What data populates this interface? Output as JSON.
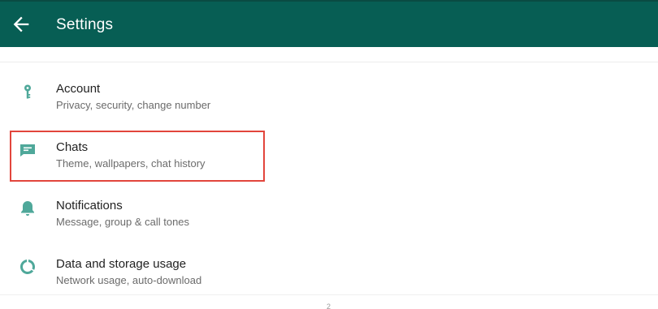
{
  "header": {
    "title": "Settings",
    "back_icon": "arrow-left-icon"
  },
  "colors": {
    "header_bg": "#075e54",
    "accent_icon": "#4fa89a",
    "highlight_border": "#e2453c"
  },
  "settings": {
    "items": [
      {
        "label": "Account",
        "subtitle": "Privacy, security, change number",
        "icon": "key-icon"
      },
      {
        "label": "Chats",
        "subtitle": "Theme, wallpapers, chat history",
        "icon": "chat-icon"
      },
      {
        "label": "Notifications",
        "subtitle": "Message, group & call tones",
        "icon": "bell-icon"
      },
      {
        "label": "Data and storage usage",
        "subtitle": "Network usage, auto-download",
        "icon": "data-usage-icon"
      }
    ]
  },
  "footer": {
    "page_number": "2"
  }
}
